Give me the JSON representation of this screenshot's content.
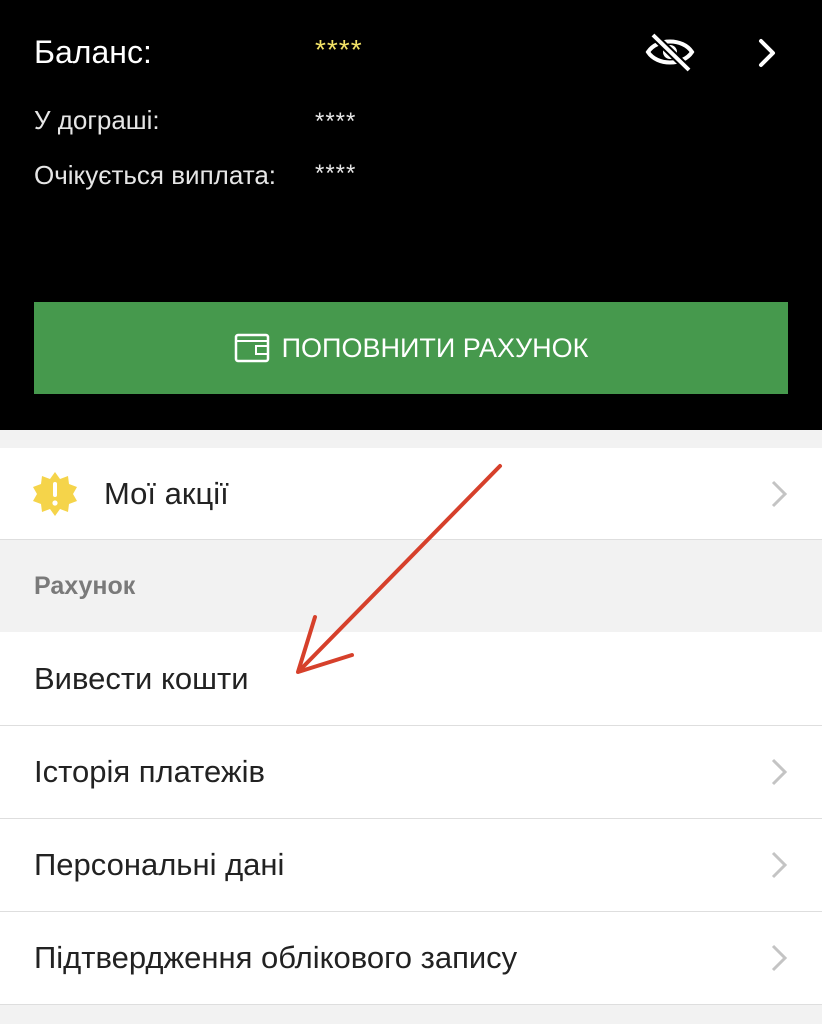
{
  "balance": {
    "label": "Баланс:",
    "value": "****",
    "in_play_label": "У дограші:",
    "in_play_value": "****",
    "pending_label": "Очікується виплата:",
    "pending_value": "****"
  },
  "topup": {
    "label": "ПОПОВНИТИ РАХУНОК"
  },
  "promos": {
    "label": "Мої акції"
  },
  "account_section": {
    "title": "Рахунок"
  },
  "menu": {
    "withdraw": "Вивести кошти",
    "history": "Історія платежів",
    "personal": "Персональні дані",
    "verify": "Підтвердження облікового запису"
  },
  "colors": {
    "header_bg": "#000000",
    "accent_green": "#46994d",
    "balance_value": "#f2e266",
    "badge_yellow": "#f5d44a",
    "annotation_arrow": "#d6402b"
  },
  "icons": [
    "eye-slash-icon",
    "chevron-right-icon",
    "wallet-icon",
    "alert-badge-icon"
  ]
}
